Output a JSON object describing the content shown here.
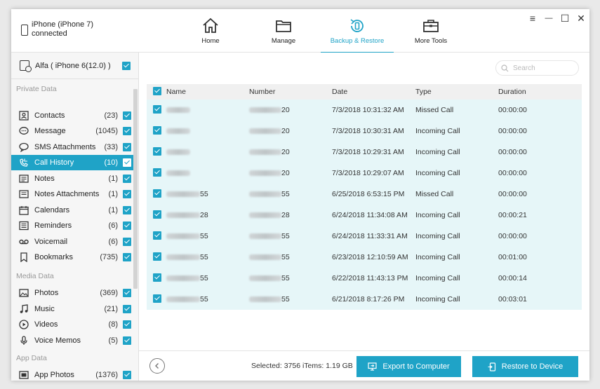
{
  "device": {
    "name_line1": "iPhone (iPhone 7)",
    "name_line2": "connected"
  },
  "nav": [
    {
      "label": "Home",
      "icon": "home-icon"
    },
    {
      "label": "Manage",
      "icon": "folder-icon"
    },
    {
      "label": "Backup & Restore",
      "icon": "backup-restore-icon",
      "active": true
    },
    {
      "label": "More Tools",
      "icon": "toolbox-icon"
    }
  ],
  "window_controls": {
    "menu": "≡",
    "minimize": "—",
    "maximize": "☐",
    "close": "✕"
  },
  "sidebar": {
    "device_name": "Alfa ( iPhone 6(12.0) )",
    "sections": {
      "private": "Private Data",
      "media": "Media Data",
      "app": "App Data"
    },
    "items": [
      {
        "label": "Contacts",
        "count": "(23)",
        "icon": "contacts-icon"
      },
      {
        "label": "Message",
        "count": "(1045)",
        "icon": "message-icon"
      },
      {
        "label": "SMS Attachments",
        "count": "(33)",
        "icon": "sms-attachments-icon"
      },
      {
        "label": "Call History",
        "count": "(10)",
        "icon": "call-history-icon",
        "active": true
      },
      {
        "label": "Notes",
        "count": "(1)",
        "icon": "notes-icon"
      },
      {
        "label": "Notes Attachments",
        "count": "(1)",
        "icon": "notes-attachments-icon"
      },
      {
        "label": "Calendars",
        "count": "(1)",
        "icon": "calendar-icon"
      },
      {
        "label": "Reminders",
        "count": "(6)",
        "icon": "reminders-icon"
      },
      {
        "label": "Voicemail",
        "count": "(6)",
        "icon": "voicemail-icon"
      },
      {
        "label": "Bookmarks",
        "count": "(735)",
        "icon": "bookmark-icon"
      },
      {
        "label": "Photos",
        "count": "(369)",
        "icon": "photos-icon"
      },
      {
        "label": "Music",
        "count": "(21)",
        "icon": "music-icon"
      },
      {
        "label": "Videos",
        "count": "(8)",
        "icon": "video-icon"
      },
      {
        "label": "Voice Memos",
        "count": "(5)",
        "icon": "microphone-icon"
      },
      {
        "label": "App Photos",
        "count": "(1376)",
        "icon": "app-photos-icon"
      }
    ]
  },
  "search": {
    "placeholder": "Search"
  },
  "table": {
    "headers": {
      "name": "Name",
      "number": "Number",
      "date": "Date",
      "type": "Type",
      "duration": "Duration"
    },
    "rows": [
      {
        "name_suffix": "",
        "number_suffix": "20",
        "date": "7/3/2018 10:31:32 AM",
        "type": "Missed Call",
        "duration": "00:00:00"
      },
      {
        "name_suffix": "",
        "number_suffix": "20",
        "date": "7/3/2018 10:30:31 AM",
        "type": "Incoming Call",
        "duration": "00:00:00"
      },
      {
        "name_suffix": "",
        "number_suffix": "20",
        "date": "7/3/2018 10:29:31 AM",
        "type": "Incoming Call",
        "duration": "00:00:00"
      },
      {
        "name_suffix": "",
        "number_suffix": "20",
        "date": "7/3/2018 10:29:07 AM",
        "type": "Incoming Call",
        "duration": "00:00:00"
      },
      {
        "name_suffix": "55",
        "number_suffix": "55",
        "date": "6/25/2018 6:53:15 PM",
        "type": "Missed Call",
        "duration": "00:00:00"
      },
      {
        "name_suffix": "28",
        "number_suffix": "28",
        "date": "6/24/2018 11:34:08 AM",
        "type": "Incoming Call",
        "duration": "00:00:21"
      },
      {
        "name_suffix": "55",
        "number_suffix": "55",
        "date": "6/24/2018 11:33:31 AM",
        "type": "Incoming Call",
        "duration": "00:00:00"
      },
      {
        "name_suffix": "55",
        "number_suffix": "55",
        "date": "6/23/2018 12:10:59 AM",
        "type": "Incoming Call",
        "duration": "00:01:00"
      },
      {
        "name_suffix": "55",
        "number_suffix": "55",
        "date": "6/22/2018 11:43:13 PM",
        "type": "Incoming Call",
        "duration": "00:00:14"
      },
      {
        "name_suffix": "55",
        "number_suffix": "55",
        "date": "6/21/2018 8:17:26 PM",
        "type": "Incoming Call",
        "duration": "00:03:01"
      }
    ]
  },
  "footer": {
    "selection_info": "Selected: 3756 iTems: 1.19 GB",
    "export_label": "Export to Computer",
    "restore_label": "Restore to Device"
  },
  "colors": {
    "accent": "#1fa3c7",
    "row_bg": "#e6f6f8"
  }
}
